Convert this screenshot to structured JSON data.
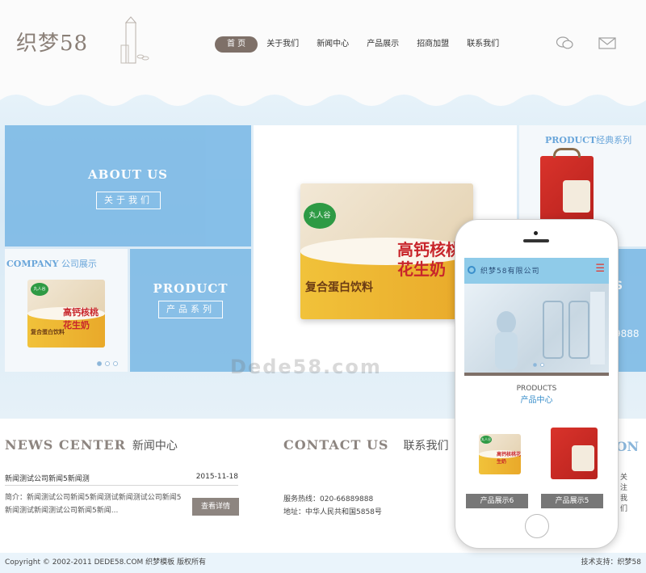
{
  "header": {
    "logo": "织梦58",
    "nav": [
      "首 页",
      "关于我们",
      "新闻中心",
      "产品展示",
      "招商加盟",
      "联系我们"
    ],
    "icons": [
      "wechat-icon",
      "mail-icon"
    ]
  },
  "banner": {
    "about": {
      "en": "ABOUT US",
      "cn": "关于我们"
    },
    "company": {
      "en": "COMPANY",
      "cn": "公司展示"
    },
    "product": {
      "en": "PRODUCT",
      "cn": "产品系列"
    },
    "product_top": {
      "en": "PRODUCT",
      "cn": "经典系列"
    },
    "right_phone_fragment": "9888",
    "right_s": "S",
    "watermark": "Dede58.com",
    "package_brand": "丸人谷",
    "package_title": "高钙核桃花生奶",
    "package_subtitle": "复合蛋白饮料"
  },
  "news": {
    "en": "NEWS CENTER",
    "cn": "新闻中心",
    "item_title": "新闻测试公司新闻5新闻测",
    "item_date": "2015-11-18",
    "summary": "简介：新闻测试公司新闻5新闻测试新闻测试公司新闻5新闻测试新闻测试公司新闻5新闻...",
    "more": "查看详情"
  },
  "contact": {
    "en": "CONTACT US",
    "cn": "联系我们",
    "phone": "服务热线：020-66889888",
    "address": "地址：中华人民共和国5858号"
  },
  "side": {
    "en": "ION",
    "cn": "关注我们"
  },
  "footer": {
    "copyright": "Copyright © 2002-2011 DEDE58.COM 织梦模板 版权所有",
    "support": "技术支持：织梦58"
  },
  "phone": {
    "title": "织梦58有限公司",
    "products_en": "PRODUCTS",
    "products_cn": "产品中心",
    "items": [
      "产品展示6",
      "产品展示5"
    ]
  },
  "colors": {
    "accent_brown": "#7e7068",
    "sky_blue": "#7fbbe6",
    "title_blue": "#6aa6da"
  }
}
